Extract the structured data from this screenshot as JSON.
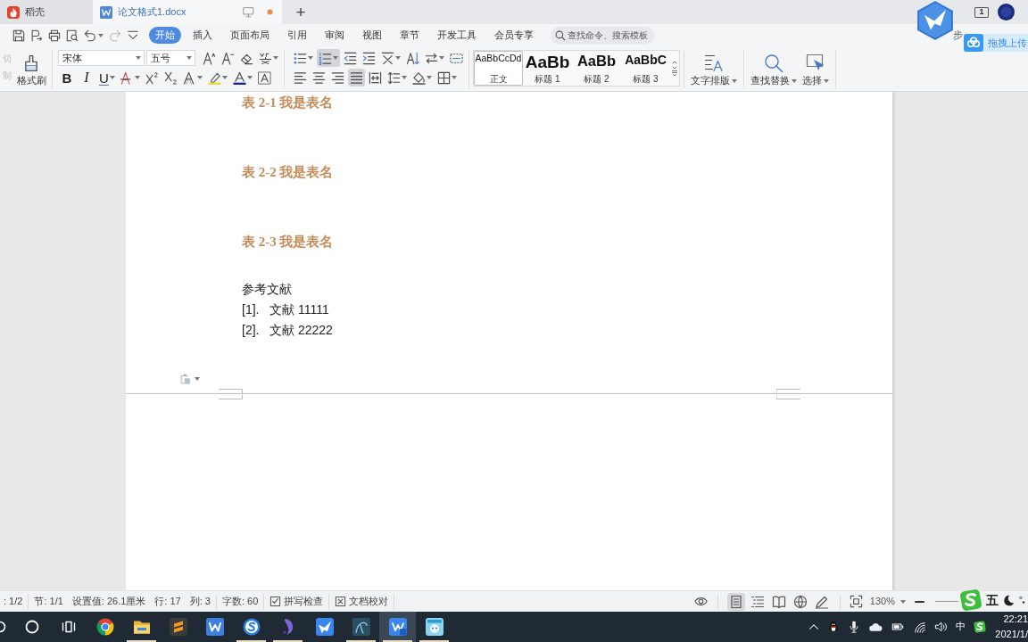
{
  "title_tabs": [
    {
      "kind": "home",
      "label": "稻壳",
      "selected": false,
      "unsaved": false
    },
    {
      "kind": "document",
      "label": "论文格式1.docx",
      "selected": true,
      "unsaved": true
    }
  ],
  "new_tab": "+",
  "window_count": "1",
  "quick_access": [
    {
      "kind": "save",
      "disabled": false
    },
    {
      "kind": "export",
      "disabled": false
    },
    {
      "kind": "print",
      "disabled": false
    },
    {
      "kind": "preview",
      "disabled": false
    },
    {
      "kind": "undo",
      "disabled": false
    },
    {
      "kind": "redo",
      "disabled": true
    },
    {
      "kind": "more",
      "disabled": false
    }
  ],
  "ribbon_tabs": [
    {
      "label": "开始",
      "selected": true
    },
    {
      "label": "插入",
      "selected": false
    },
    {
      "label": "页面布局",
      "selected": false
    },
    {
      "label": "引用",
      "selected": false
    },
    {
      "label": "审阅",
      "selected": false
    },
    {
      "label": "视图",
      "selected": false
    },
    {
      "label": "章节",
      "selected": false
    },
    {
      "label": "开发工具",
      "selected": false
    },
    {
      "label": "会员专享",
      "selected": false
    }
  ],
  "command_search": {
    "placeholder": "查找命令、搜索模板"
  },
  "sync_label": "步",
  "upload_button": {
    "label": "拖拽上传"
  },
  "ribbon": {
    "clipboard": [
      {
        "label": "切",
        "disabled": true
      },
      {
        "label": "制",
        "disabled": true
      }
    ],
    "format_painter": "格式刷",
    "font_name": "宋体",
    "font_size": "五号",
    "font_tools": [
      {
        "kind": "grow",
        "menu": false
      },
      {
        "kind": "shrink",
        "menu": false
      },
      {
        "kind": "clear",
        "menu": false
      },
      {
        "kind": "pinyin",
        "menu": true
      }
    ],
    "format_tools": [
      {
        "kind": "bold",
        "glyph": "B",
        "menu": false
      },
      {
        "kind": "italic",
        "glyph": "I",
        "menu": false
      },
      {
        "kind": "underline",
        "glyph": "U",
        "menu": true
      },
      {
        "kind": "strike",
        "menu": true
      },
      {
        "kind": "superscript",
        "menu": false
      },
      {
        "kind": "subscript",
        "menu": false
      },
      {
        "kind": "effect",
        "menu": true
      },
      {
        "kind": "highlight",
        "menu": true
      },
      {
        "kind": "font-color",
        "menu": true
      },
      {
        "kind": "char-border",
        "menu": false
      }
    ],
    "paragraph_row_1": [
      {
        "kind": "bullets",
        "active": false,
        "menu": true
      },
      {
        "kind": "numbering",
        "active": true,
        "menu": true
      },
      {
        "kind": "outdent",
        "active": false,
        "menu": false
      },
      {
        "kind": "indent",
        "active": false,
        "menu": false
      },
      {
        "kind": "asian-layout",
        "active": false,
        "menu": true
      },
      {
        "kind": "sort",
        "active": false,
        "menu": false
      },
      {
        "kind": "swap",
        "active": false,
        "menu": true
      },
      {
        "kind": "dashed-frame",
        "active": false,
        "menu": false
      }
    ],
    "paragraph_row_2": [
      {
        "kind": "left",
        "active": false,
        "menu": false
      },
      {
        "kind": "center",
        "active": false,
        "menu": false
      },
      {
        "kind": "right",
        "active": false,
        "menu": false
      },
      {
        "kind": "justify",
        "active": true,
        "menu": false
      },
      {
        "kind": "distributed",
        "active": false,
        "menu": false
      },
      {
        "kind": "line-spacing",
        "active": false,
        "menu": true
      },
      {
        "kind": "shading",
        "active": false,
        "menu": true
      },
      {
        "kind": "borders",
        "active": false,
        "menu": true
      }
    ],
    "styles": [
      {
        "preview": "AaBbCcDd",
        "label": "正文",
        "selected": true
      },
      {
        "preview": "AaBb",
        "label": "标题 1",
        "selected": false
      },
      {
        "preview": "AaBb",
        "label": "标题 2",
        "selected": false
      },
      {
        "preview": "AaBbC",
        "label": "标题 3",
        "selected": false
      }
    ],
    "tools": [
      {
        "kind": "text-layout",
        "label": "文字排版",
        "menu": true
      },
      {
        "kind": "find-replace",
        "label": "查找替换",
        "menu": true
      },
      {
        "kind": "select",
        "label": "选择",
        "menu": true
      }
    ]
  },
  "document": {
    "paragraphs": [
      {
        "kind": "caption",
        "text": "表 2-1 我是表名"
      },
      {
        "kind": "caption",
        "text": "表 2-2 我是表名"
      },
      {
        "kind": "caption",
        "text": "表 2-3 我是表名"
      },
      {
        "kind": "heading",
        "text": "参考文献"
      },
      {
        "kind": "reference",
        "number": "[1].",
        "text": "文献 11111"
      },
      {
        "kind": "reference",
        "number": "[2].",
        "text": "文献 22222"
      }
    ]
  },
  "status_bar": {
    "field_groups": [
      [
        ": 1/2"
      ],
      [
        "节: 1/1",
        "设置值: 26.1厘米",
        "行: 17",
        "列: 3"
      ],
      [
        "字数: 60"
      ]
    ],
    "checks": [
      {
        "kind": "spell",
        "label": "拼写检查"
      },
      {
        "kind": "proofread",
        "label": "文档校对"
      }
    ],
    "views": [
      {
        "kind": "page",
        "selected": true
      },
      {
        "kind": "outline",
        "selected": false
      },
      {
        "kind": "reading",
        "selected": false
      },
      {
        "kind": "web",
        "selected": false
      },
      {
        "kind": "writing",
        "selected": false
      }
    ],
    "zoom": "130%"
  },
  "ime": {
    "mode": "五"
  },
  "taskbar": {
    "apps": [
      {
        "kind": "chrome",
        "running": false,
        "active": false
      },
      {
        "kind": "folder",
        "running": true,
        "active": false
      },
      {
        "kind": "sublime",
        "running": false,
        "active": false
      },
      {
        "kind": "writer",
        "running": false,
        "active": false
      },
      {
        "kind": "s-browser",
        "running": true,
        "active": false
      },
      {
        "kind": "dolphin",
        "running": true,
        "active": false
      },
      {
        "kind": "bird",
        "running": false,
        "active": false
      },
      {
        "kind": "dolphin-line",
        "running": true,
        "active": false
      },
      {
        "kind": "w-doc",
        "running": true,
        "active": true
      },
      {
        "kind": "picture-app",
        "running": true,
        "active": false
      }
    ],
    "tray": {
      "language": "中",
      "time": "22:21",
      "date": "2021/1/"
    }
  }
}
